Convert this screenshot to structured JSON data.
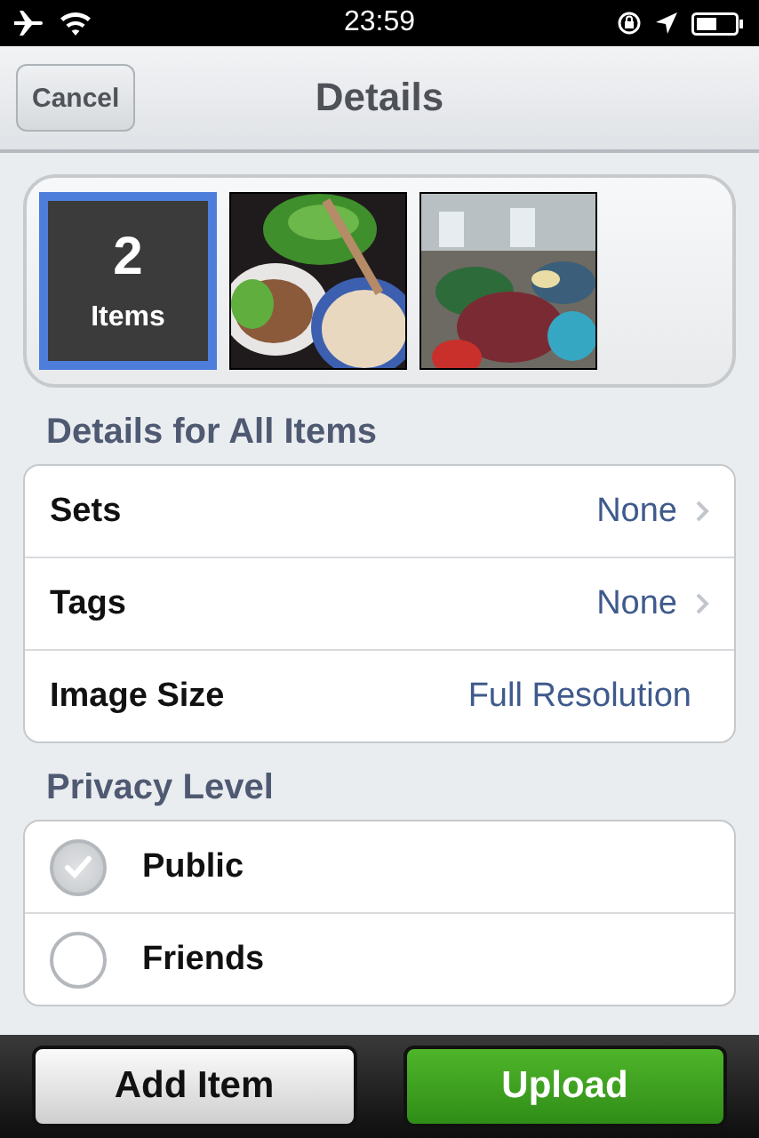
{
  "status_bar": {
    "time": "23:59"
  },
  "nav_bar": {
    "title": "Details",
    "left_button": "Cancel"
  },
  "items_strip": {
    "count": "2",
    "count_label": "Items",
    "selected": true
  },
  "sections": [
    {
      "header": "Details for All Items",
      "rows": [
        {
          "kind": "value",
          "label": "Sets",
          "value": "None",
          "disclosure": true
        },
        {
          "kind": "value",
          "label": "Tags",
          "value": "None",
          "disclosure": true
        },
        {
          "kind": "value",
          "label": "Image Size",
          "value": "Full Resolution",
          "disclosure": false
        }
      ]
    },
    {
      "header": "Privacy Level",
      "rows": [
        {
          "kind": "radio",
          "label": "Public",
          "checked": true
        },
        {
          "kind": "radio",
          "label": "Friends",
          "checked": false
        }
      ]
    }
  ],
  "toolbar": {
    "buttons": [
      {
        "label": "Add Item",
        "kind": "plain"
      },
      {
        "label": "Upload",
        "kind": "primary"
      }
    ]
  }
}
